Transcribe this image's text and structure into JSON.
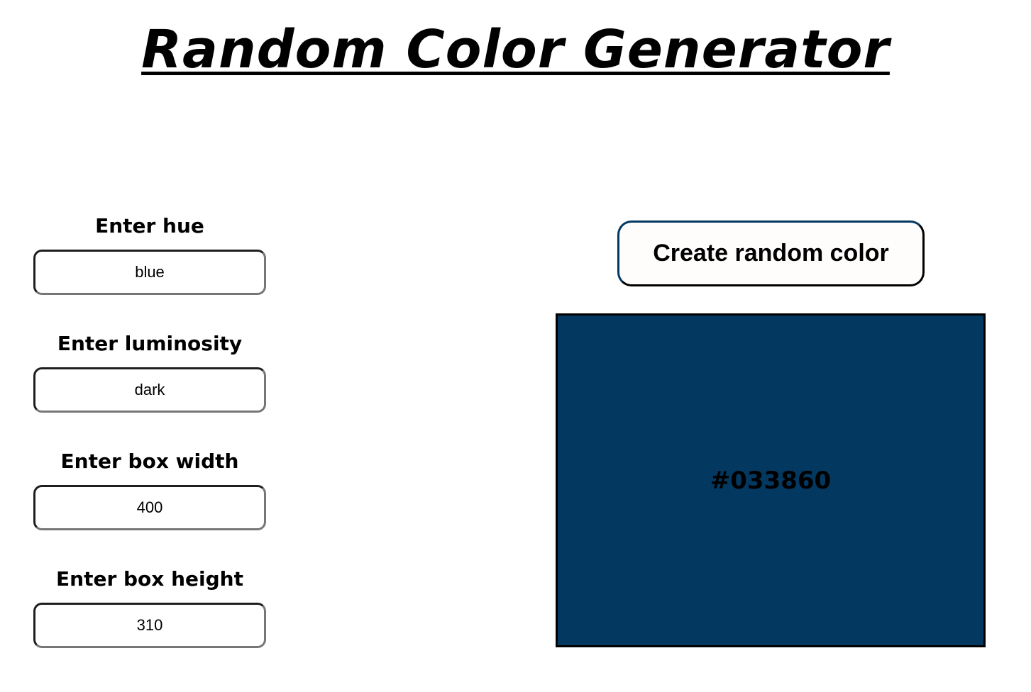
{
  "title": "Random Color Generator",
  "fields": {
    "hue": {
      "label": "Enter hue",
      "value": "blue"
    },
    "luminosity": {
      "label": "Enter luminosity",
      "value": "dark"
    },
    "width": {
      "label": "Enter box width",
      "value": "400"
    },
    "height": {
      "label": "Enter box height",
      "value": "310"
    }
  },
  "generate_button": {
    "label": "Create random color"
  },
  "color_box": {
    "hex_label": "#033860",
    "background_color": "#033860"
  }
}
